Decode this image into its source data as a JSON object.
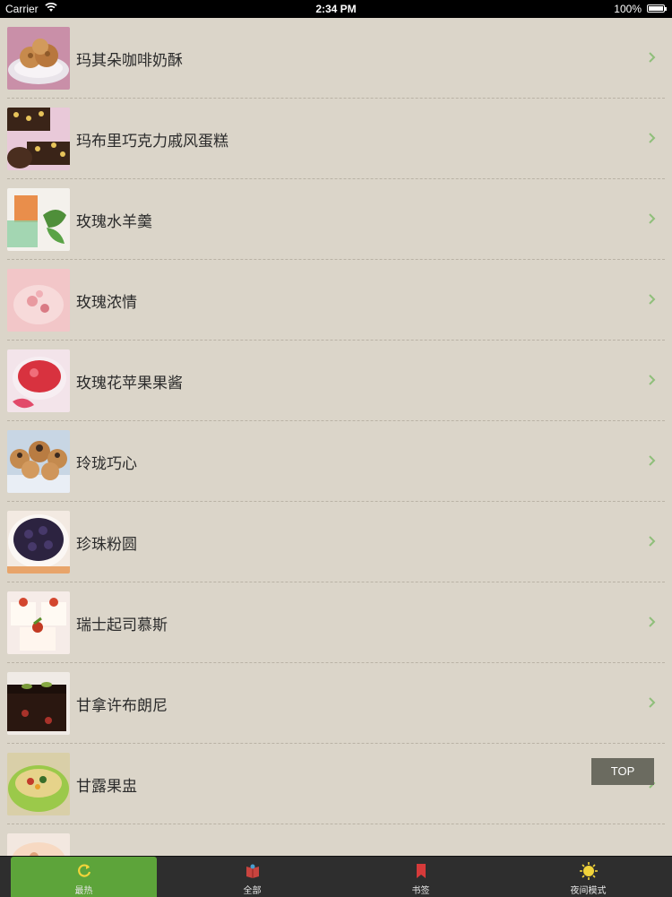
{
  "status_bar": {
    "carrier": "Carrier",
    "time": "2:34 PM",
    "battery": "100%"
  },
  "recipes": [
    {
      "title": "玛其朵咖啡奶酥",
      "thumb_icon": "cookie-plate-photo"
    },
    {
      "title": "玛布里巧克力戚风蛋糕",
      "thumb_icon": "chocolate-cupcake-photo"
    },
    {
      "title": "玫瑰水羊羹",
      "thumb_icon": "rose-jelly-photo"
    },
    {
      "title": "玫瑰浓情",
      "thumb_icon": "rose-drink-photo"
    },
    {
      "title": "玫瑰花苹果果酱",
      "thumb_icon": "rose-jam-photo"
    },
    {
      "title": "玲珑巧心",
      "thumb_icon": "cream-puff-photo"
    },
    {
      "title": "珍珠粉圆",
      "thumb_icon": "tapioca-bowl-photo"
    },
    {
      "title": "瑞士起司慕斯",
      "thumb_icon": "cheese-mousse-photo"
    },
    {
      "title": "甘拿许布朗尼",
      "thumb_icon": "brownie-photo"
    },
    {
      "title": "甘露果盅",
      "thumb_icon": "melon-cup-photo"
    },
    {
      "title": "",
      "thumb_icon": "partial-dessert-photo"
    }
  ],
  "top_button": "TOP",
  "tabs": [
    {
      "label": "最热",
      "icon": "refresh-icon",
      "active": true
    },
    {
      "label": "全部",
      "icon": "book-icon",
      "active": false
    },
    {
      "label": "书签",
      "icon": "bookmark-icon",
      "active": false
    },
    {
      "label": "夜间模式",
      "icon": "sun-icon",
      "active": false
    }
  ],
  "colors": {
    "background": "#dbd5c9",
    "tab_bar": "#2e2e2e",
    "tab_active": "#5da43a",
    "chevron": "#8fbf7a"
  }
}
